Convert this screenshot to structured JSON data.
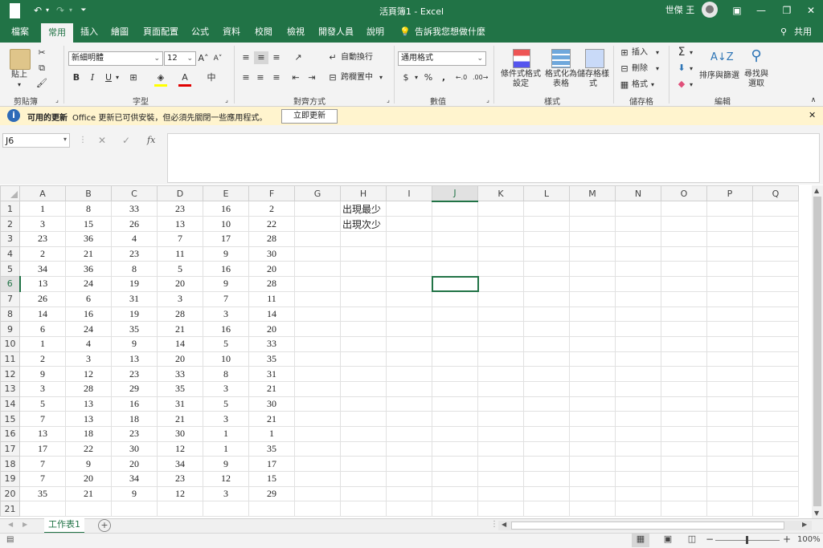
{
  "window": {
    "title": "活頁簿1  -  Excel",
    "user": "世傑 王"
  },
  "tabs": [
    "檔案",
    "常用",
    "插入",
    "繪圖",
    "頁面配置",
    "公式",
    "資料",
    "校閱",
    "檢視",
    "開發人員",
    "說明",
    "告訴我您想做什麼"
  ],
  "share_label": "共用",
  "ribbon": {
    "clipboard": {
      "paste": "貼上",
      "label": "剪貼簿"
    },
    "font": {
      "name": "新細明體",
      "size": "12",
      "bold": "B",
      "italic": "I",
      "underline": "U",
      "label": "字型"
    },
    "alignment": {
      "wrap": "自動換行",
      "merge": "跨欄置中",
      "label": "對齊方式"
    },
    "number": {
      "format": "通用格式",
      "currency": "$",
      "percent": "%",
      "comma": ",",
      "label": "數值"
    },
    "styles": {
      "cond": "條件式格式設定",
      "table": "格式化為表格",
      "cell": "儲存格樣式",
      "label": "樣式"
    },
    "cells": {
      "insert": "插入",
      "delete": "刪除",
      "format": "格式",
      "label": "儲存格"
    },
    "editing": {
      "sort": "排序與篩選",
      "find": "尋找與選取",
      "label": "編輯"
    }
  },
  "infobar": {
    "title": "可用的更新",
    "message": "Office 更新已可供安裝，但必須先關閉一些應用程式。",
    "button": "立即更新"
  },
  "formula": {
    "namebox": "J6",
    "fx": "fx",
    "content": ""
  },
  "sheet": {
    "columns": [
      "A",
      "B",
      "C",
      "D",
      "E",
      "F",
      "G",
      "H",
      "I",
      "J",
      "K",
      "L",
      "M",
      "N",
      "O",
      "P",
      "Q"
    ],
    "selected_column": "J",
    "selected_row": 6,
    "rows": [
      [
        "1",
        "8",
        "33",
        "23",
        "16",
        "2",
        "",
        "出現最少"
      ],
      [
        "3",
        "15",
        "26",
        "13",
        "10",
        "22",
        "",
        "出現次少"
      ],
      [
        "23",
        "36",
        "4",
        "7",
        "17",
        "28"
      ],
      [
        "2",
        "21",
        "23",
        "11",
        "9",
        "30"
      ],
      [
        "34",
        "36",
        "8",
        "5",
        "16",
        "20"
      ],
      [
        "13",
        "24",
        "19",
        "20",
        "9",
        "28"
      ],
      [
        "26",
        "6",
        "31",
        "3",
        "7",
        "11"
      ],
      [
        "14",
        "16",
        "19",
        "28",
        "3",
        "14"
      ],
      [
        "6",
        "24",
        "35",
        "21",
        "16",
        "20"
      ],
      [
        "1",
        "4",
        "9",
        "14",
        "5",
        "33"
      ],
      [
        "2",
        "3",
        "13",
        "20",
        "10",
        "35"
      ],
      [
        "9",
        "12",
        "23",
        "33",
        "8",
        "31"
      ],
      [
        "3",
        "28",
        "29",
        "35",
        "3",
        "21"
      ],
      [
        "5",
        "13",
        "16",
        "31",
        "5",
        "30"
      ],
      [
        "7",
        "13",
        "18",
        "21",
        "3",
        "21"
      ],
      [
        "13",
        "18",
        "23",
        "30",
        "1",
        "1"
      ],
      [
        "17",
        "22",
        "30",
        "12",
        "1",
        "35"
      ],
      [
        "7",
        "9",
        "20",
        "34",
        "9",
        "17"
      ],
      [
        "7",
        "20",
        "34",
        "23",
        "12",
        "15"
      ],
      [
        "35",
        "21",
        "9",
        "12",
        "3",
        "29"
      ],
      []
    ],
    "sheet_tab": "工作表1"
  },
  "status": {
    "zoom": "100%"
  }
}
